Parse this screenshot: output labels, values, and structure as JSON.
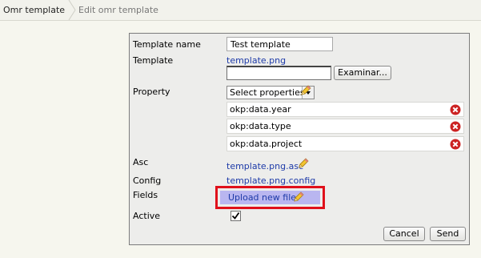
{
  "breadcrumb": {
    "items": [
      "Omr template",
      "Edit omr template"
    ]
  },
  "form": {
    "template_name_label": "Template name",
    "template_name_value": "Test template",
    "template_label": "Template",
    "template_link": "template.png",
    "browse_button": "Examinar...",
    "property_label": "Property",
    "select_value": "Select properties",
    "properties": [
      "okp:data.year",
      "okp:data.type",
      "okp:data.project"
    ],
    "asc_label": "Asc",
    "asc_link": "template.png.asc",
    "config_label": "Config",
    "config_link": "template.png.config",
    "fields_label": "Fields",
    "fields_link": "Upload new file",
    "active_label": "Active",
    "active_checked": true,
    "cancel_button": "Cancel",
    "send_button": "Send"
  },
  "colors": {
    "link": "#1d3aa8",
    "highlight": "#e0101a",
    "remove": "#cc2222"
  }
}
